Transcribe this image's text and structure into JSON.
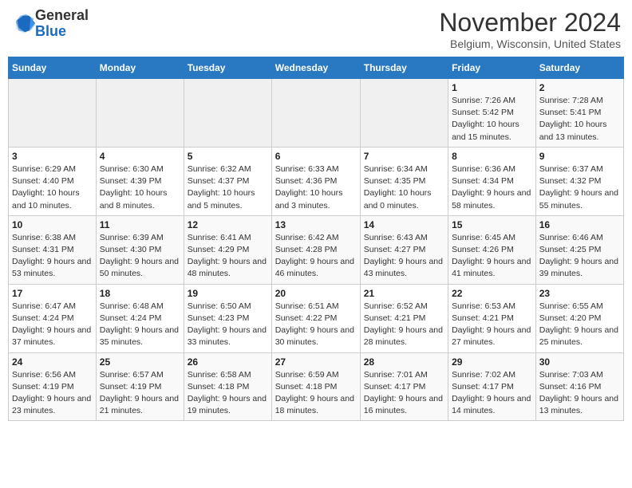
{
  "header": {
    "logo_general": "General",
    "logo_blue": "Blue",
    "month_title": "November 2024",
    "location": "Belgium, Wisconsin, United States"
  },
  "weekdays": [
    "Sunday",
    "Monday",
    "Tuesday",
    "Wednesday",
    "Thursday",
    "Friday",
    "Saturday"
  ],
  "weeks": [
    [
      {
        "day": "",
        "sunrise": "",
        "sunset": "",
        "daylight": ""
      },
      {
        "day": "",
        "sunrise": "",
        "sunset": "",
        "daylight": ""
      },
      {
        "day": "",
        "sunrise": "",
        "sunset": "",
        "daylight": ""
      },
      {
        "day": "",
        "sunrise": "",
        "sunset": "",
        "daylight": ""
      },
      {
        "day": "",
        "sunrise": "",
        "sunset": "",
        "daylight": ""
      },
      {
        "day": "1",
        "sunrise": "Sunrise: 7:26 AM",
        "sunset": "Sunset: 5:42 PM",
        "daylight": "Daylight: 10 hours and 15 minutes."
      },
      {
        "day": "2",
        "sunrise": "Sunrise: 7:28 AM",
        "sunset": "Sunset: 5:41 PM",
        "daylight": "Daylight: 10 hours and 13 minutes."
      }
    ],
    [
      {
        "day": "3",
        "sunrise": "Sunrise: 6:29 AM",
        "sunset": "Sunset: 4:40 PM",
        "daylight": "Daylight: 10 hours and 10 minutes."
      },
      {
        "day": "4",
        "sunrise": "Sunrise: 6:30 AM",
        "sunset": "Sunset: 4:39 PM",
        "daylight": "Daylight: 10 hours and 8 minutes."
      },
      {
        "day": "5",
        "sunrise": "Sunrise: 6:32 AM",
        "sunset": "Sunset: 4:37 PM",
        "daylight": "Daylight: 10 hours and 5 minutes."
      },
      {
        "day": "6",
        "sunrise": "Sunrise: 6:33 AM",
        "sunset": "Sunset: 4:36 PM",
        "daylight": "Daylight: 10 hours and 3 minutes."
      },
      {
        "day": "7",
        "sunrise": "Sunrise: 6:34 AM",
        "sunset": "Sunset: 4:35 PM",
        "daylight": "Daylight: 10 hours and 0 minutes."
      },
      {
        "day": "8",
        "sunrise": "Sunrise: 6:36 AM",
        "sunset": "Sunset: 4:34 PM",
        "daylight": "Daylight: 9 hours and 58 minutes."
      },
      {
        "day": "9",
        "sunrise": "Sunrise: 6:37 AM",
        "sunset": "Sunset: 4:32 PM",
        "daylight": "Daylight: 9 hours and 55 minutes."
      }
    ],
    [
      {
        "day": "10",
        "sunrise": "Sunrise: 6:38 AM",
        "sunset": "Sunset: 4:31 PM",
        "daylight": "Daylight: 9 hours and 53 minutes."
      },
      {
        "day": "11",
        "sunrise": "Sunrise: 6:39 AM",
        "sunset": "Sunset: 4:30 PM",
        "daylight": "Daylight: 9 hours and 50 minutes."
      },
      {
        "day": "12",
        "sunrise": "Sunrise: 6:41 AM",
        "sunset": "Sunset: 4:29 PM",
        "daylight": "Daylight: 9 hours and 48 minutes."
      },
      {
        "day": "13",
        "sunrise": "Sunrise: 6:42 AM",
        "sunset": "Sunset: 4:28 PM",
        "daylight": "Daylight: 9 hours and 46 minutes."
      },
      {
        "day": "14",
        "sunrise": "Sunrise: 6:43 AM",
        "sunset": "Sunset: 4:27 PM",
        "daylight": "Daylight: 9 hours and 43 minutes."
      },
      {
        "day": "15",
        "sunrise": "Sunrise: 6:45 AM",
        "sunset": "Sunset: 4:26 PM",
        "daylight": "Daylight: 9 hours and 41 minutes."
      },
      {
        "day": "16",
        "sunrise": "Sunrise: 6:46 AM",
        "sunset": "Sunset: 4:25 PM",
        "daylight": "Daylight: 9 hours and 39 minutes."
      }
    ],
    [
      {
        "day": "17",
        "sunrise": "Sunrise: 6:47 AM",
        "sunset": "Sunset: 4:24 PM",
        "daylight": "Daylight: 9 hours and 37 minutes."
      },
      {
        "day": "18",
        "sunrise": "Sunrise: 6:48 AM",
        "sunset": "Sunset: 4:24 PM",
        "daylight": "Daylight: 9 hours and 35 minutes."
      },
      {
        "day": "19",
        "sunrise": "Sunrise: 6:50 AM",
        "sunset": "Sunset: 4:23 PM",
        "daylight": "Daylight: 9 hours and 33 minutes."
      },
      {
        "day": "20",
        "sunrise": "Sunrise: 6:51 AM",
        "sunset": "Sunset: 4:22 PM",
        "daylight": "Daylight: 9 hours and 30 minutes."
      },
      {
        "day": "21",
        "sunrise": "Sunrise: 6:52 AM",
        "sunset": "Sunset: 4:21 PM",
        "daylight": "Daylight: 9 hours and 28 minutes."
      },
      {
        "day": "22",
        "sunrise": "Sunrise: 6:53 AM",
        "sunset": "Sunset: 4:21 PM",
        "daylight": "Daylight: 9 hours and 27 minutes."
      },
      {
        "day": "23",
        "sunrise": "Sunrise: 6:55 AM",
        "sunset": "Sunset: 4:20 PM",
        "daylight": "Daylight: 9 hours and 25 minutes."
      }
    ],
    [
      {
        "day": "24",
        "sunrise": "Sunrise: 6:56 AM",
        "sunset": "Sunset: 4:19 PM",
        "daylight": "Daylight: 9 hours and 23 minutes."
      },
      {
        "day": "25",
        "sunrise": "Sunrise: 6:57 AM",
        "sunset": "Sunset: 4:19 PM",
        "daylight": "Daylight: 9 hours and 21 minutes."
      },
      {
        "day": "26",
        "sunrise": "Sunrise: 6:58 AM",
        "sunset": "Sunset: 4:18 PM",
        "daylight": "Daylight: 9 hours and 19 minutes."
      },
      {
        "day": "27",
        "sunrise": "Sunrise: 6:59 AM",
        "sunset": "Sunset: 4:18 PM",
        "daylight": "Daylight: 9 hours and 18 minutes."
      },
      {
        "day": "28",
        "sunrise": "Sunrise: 7:01 AM",
        "sunset": "Sunset: 4:17 PM",
        "daylight": "Daylight: 9 hours and 16 minutes."
      },
      {
        "day": "29",
        "sunrise": "Sunrise: 7:02 AM",
        "sunset": "Sunset: 4:17 PM",
        "daylight": "Daylight: 9 hours and 14 minutes."
      },
      {
        "day": "30",
        "sunrise": "Sunrise: 7:03 AM",
        "sunset": "Sunset: 4:16 PM",
        "daylight": "Daylight: 9 hours and 13 minutes."
      }
    ]
  ]
}
